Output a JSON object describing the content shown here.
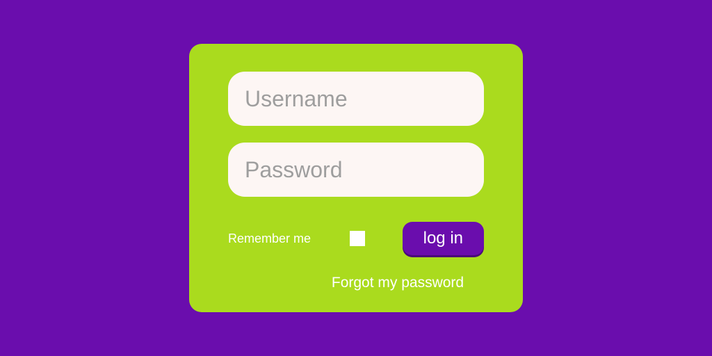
{
  "form": {
    "username_placeholder": "Username",
    "password_placeholder": "Password",
    "remember_label": "Remember me",
    "login_button_label": "log in",
    "forgot_link_label": "Forgot my password"
  },
  "colors": {
    "background": "#6a0dad",
    "card": "#aadb1e",
    "input_bg": "#fdf6f4",
    "button_bg": "#6a0dad"
  }
}
